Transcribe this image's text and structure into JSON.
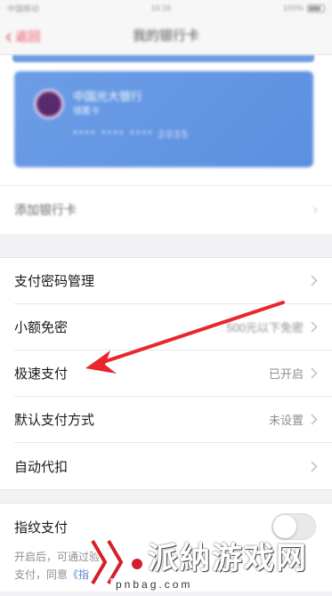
{
  "status_bar": {
    "carrier": "中国移动",
    "time": "16:16",
    "battery": "100%"
  },
  "nav": {
    "back_label": "返回",
    "title": "我的银行卡"
  },
  "card": {
    "bank_name": "中国光大银行",
    "card_type": "储蓄卡",
    "card_number": "**** **** **** 2035",
    "accent_color": "#6c9de6"
  },
  "add_card": {
    "label": "添加银行卡"
  },
  "settings": [
    {
      "name": "支付密码管理",
      "value": ""
    },
    {
      "name": "小额免密",
      "value": "500元以下免密"
    },
    {
      "name": "极速支付",
      "value": "已开启"
    },
    {
      "name": "默认支付方式",
      "value": "未设置"
    },
    {
      "name": "自动代扣",
      "value": ""
    }
  ],
  "fingerprint": {
    "label": "指纹支付",
    "enabled": false,
    "desc_line1": "开启后，可通过验",
    "desc_line2": "支付，同意",
    "desc_link": "《指"
  },
  "watermark": {
    "text": "派納游戏网",
    "url": "pnbag.com"
  },
  "annotation": {
    "color": "#e8262b"
  }
}
